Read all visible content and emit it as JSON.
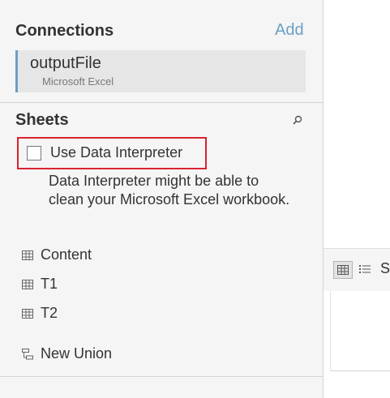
{
  "connections": {
    "title": "Connections",
    "add_label": "Add",
    "items": [
      {
        "name": "outputFile",
        "type": "Microsoft Excel"
      }
    ]
  },
  "sheets": {
    "title": "Sheets",
    "search_icon": "search-icon",
    "interpreter": {
      "label": "Use Data Interpreter",
      "checked": false,
      "description": "Data Interpreter might be able to clean your Microsoft Excel workbook."
    },
    "items": [
      {
        "label": "Content",
        "icon": "table-icon"
      },
      {
        "label": "T1",
        "icon": "table-icon"
      },
      {
        "label": "T2",
        "icon": "table-icon"
      },
      {
        "label": "New Union",
        "icon": "union-icon"
      }
    ]
  },
  "main": {
    "cut_text": "S"
  },
  "colors": {
    "accent": "#6b9fc6",
    "highlight": "#d9232e",
    "sidebar_bg": "#f5f5f5",
    "card_bg": "#e6e6e6"
  }
}
